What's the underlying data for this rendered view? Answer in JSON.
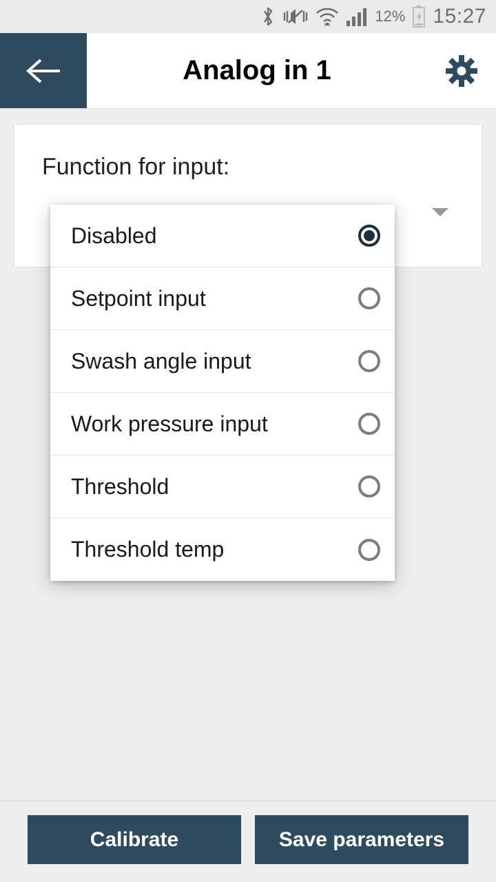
{
  "status": {
    "battery_pct": "12%",
    "time": "15:27"
  },
  "header": {
    "title": "Analog in 1"
  },
  "card": {
    "label": "Function for input:"
  },
  "options": [
    {
      "label": "Disabled",
      "selected": true
    },
    {
      "label": "Setpoint input",
      "selected": false
    },
    {
      "label": "Swash angle input",
      "selected": false
    },
    {
      "label": "Work pressure input",
      "selected": false
    },
    {
      "label": "Threshold",
      "selected": false
    },
    {
      "label": "Threshold temp",
      "selected": false
    }
  ],
  "buttons": {
    "calibrate": "Calibrate",
    "save": "Save parameters"
  },
  "colors": {
    "accent": "#2d4a5f",
    "radio_selected_fill": "#1a2e3c",
    "radio_unselected_stroke": "#7c7c7c"
  }
}
